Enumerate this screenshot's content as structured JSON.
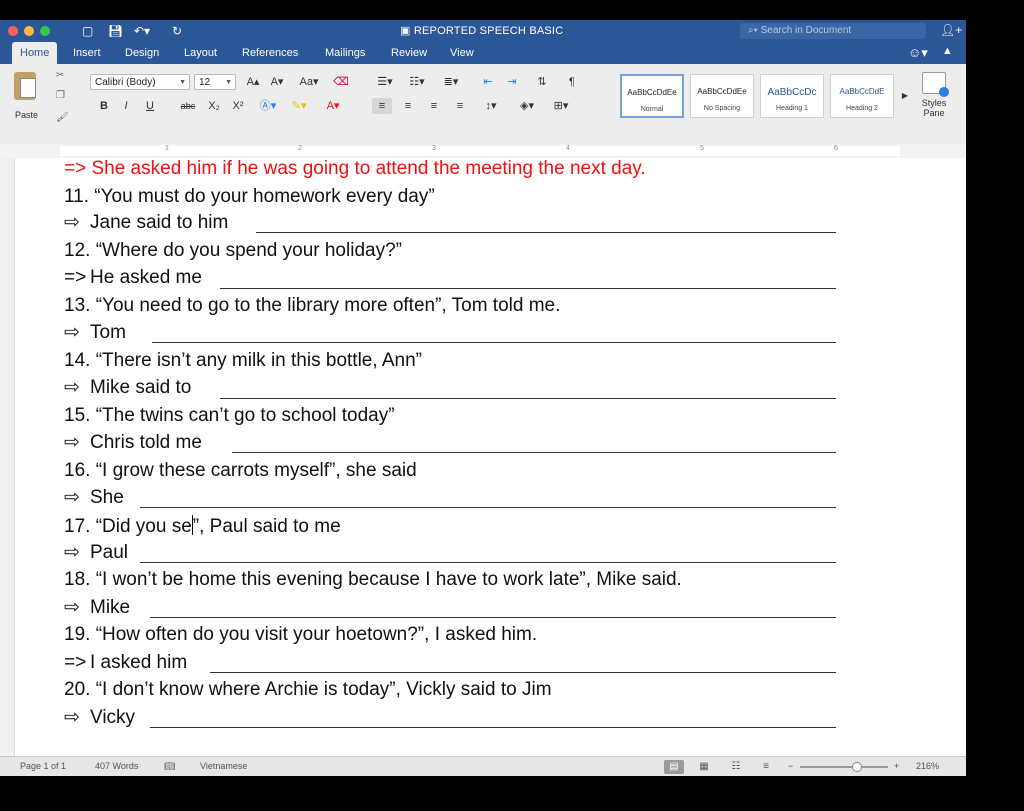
{
  "window": {
    "title": "REPORTED SPEECH BASIC",
    "search_placeholder": "Search in Document",
    "traffic_colors": [
      "#fc605c",
      "#fdbc40",
      "#34c84a"
    ]
  },
  "tabs": [
    "Home",
    "Insert",
    "Design",
    "Layout",
    "References",
    "Mailings",
    "Review",
    "View"
  ],
  "ribbon": {
    "paste_label": "Paste",
    "font_name": "Calibri (Body)",
    "font_size": "12",
    "styles": [
      {
        "preview": "AaBbCcDdEe",
        "name": "Normal"
      },
      {
        "preview": "AaBbCcDdEe",
        "name": "No Spacing"
      },
      {
        "preview": "AaBbCcDc",
        "name": "Heading 1"
      },
      {
        "preview": "AaBbCcDdE",
        "name": "Heading 2"
      }
    ],
    "styles_pane_label": "Styles Pane",
    "bold": "B",
    "italic": "I",
    "underline": "U",
    "strike": "abc",
    "subscript": "X₂",
    "superscript": "X²"
  },
  "ruler_numbers": [
    "1",
    "2",
    "3",
    "4",
    "5",
    "6"
  ],
  "document": {
    "top_line": "=> She asked him if he was going to attend the meeting the next day.",
    "items": [
      {
        "q": "11. “You must do your homework every day”",
        "prefix": "⇨",
        "a": "Jane said to him"
      },
      {
        "q": "12. “Where do you spend your holiday?”",
        "prefix": "=>",
        "a": "He asked me"
      },
      {
        "q": "13. “You need to go to the library more often”, Tom told me.",
        "prefix": "⇨",
        "a": "Tom"
      },
      {
        "q": "14. “There isn’t any milk in this bottle, Ann”",
        "prefix": "⇨",
        "a": "Mike said to"
      },
      {
        "q": "15. “The twins can’t go to school today”",
        "prefix": "⇨",
        "a": "Chris told me"
      },
      {
        "q": "16. “I grow these carrots myself”, she said",
        "prefix": "⇨",
        "a": "She"
      },
      {
        "q_before": "17. “Did you se",
        "q_after": "”, Paul said to me",
        "prefix": "⇨",
        "a": "Paul"
      },
      {
        "q": "18. “I won’t be home this evening because I have to work late”, Mike said.",
        "prefix": "⇨",
        "a": "Mike"
      },
      {
        "q": "19. “How often do you visit your hoetown?”, I asked him.",
        "prefix": "=>",
        "a": "I asked him"
      },
      {
        "q": "20. “I don’t know where Archie is today”, Vickly said to Jim",
        "prefix": "⇨",
        "a": "Vicky"
      }
    ]
  },
  "status": {
    "page": "Page 1 of 1",
    "words": "407 Words",
    "language": "Vietnamese",
    "zoom": "216%"
  }
}
